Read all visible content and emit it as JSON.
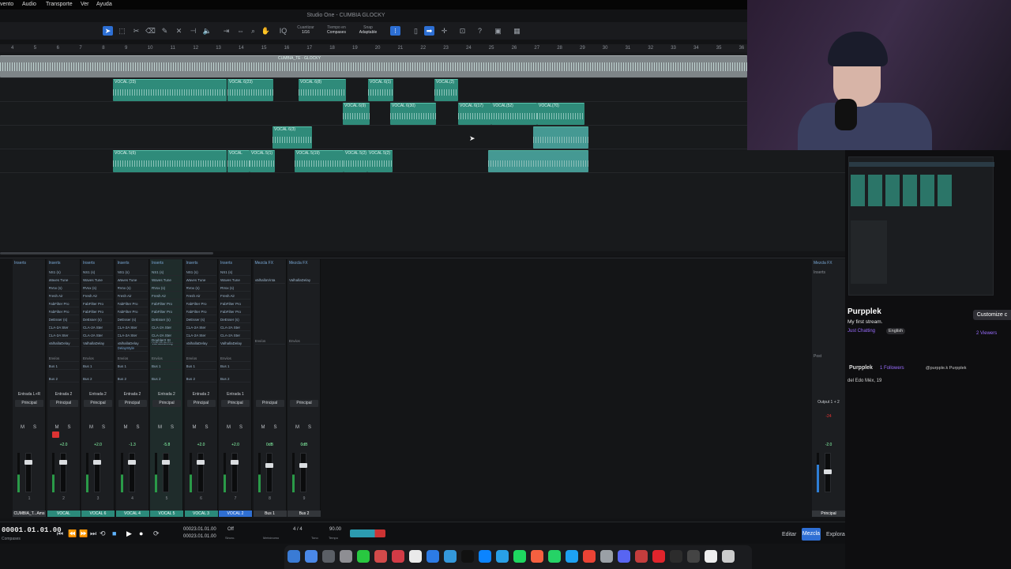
{
  "menubar": {
    "items": [
      "vento",
      "Audio",
      "Transporte",
      "Ver",
      "Ayuda"
    ]
  },
  "window": {
    "title": "Studio One - CUMBIA GLOCKY"
  },
  "toolbar": {
    "quantize_label": "Cuantizar",
    "quantize_value": "1/16",
    "timebase_label": "Tiempo en",
    "timebase_value": "Compases",
    "snap_label": "Snap",
    "snap_value": "Adaptable"
  },
  "ruler": {
    "marks": [
      "4",
      "5",
      "6",
      "7",
      "8",
      "9",
      "10",
      "11",
      "12",
      "13",
      "14",
      "15",
      "16",
      "17",
      "18",
      "19",
      "20",
      "21",
      "22",
      "23",
      "24",
      "25",
      "26",
      "27",
      "28",
      "29",
      "30",
      "31",
      "32",
      "33",
      "34",
      "35",
      "36"
    ]
  },
  "clips": {
    "master": "CUMBIA_TE - GLOCKY",
    "row1": [
      "VOCAL (23)",
      "VOCAL 6(23)",
      "VOCAL 6(8)",
      "VOCAL 6(1)",
      "VOCAL(2)"
    ],
    "row2": [
      "VOCAL 6(9)",
      "VOCAL 6(30)",
      "VOCAL 6(17)",
      "VOCAL(52)",
      "VOCAL(70)"
    ],
    "row3": [
      "VOCAL 6(3)"
    ],
    "row4": [
      "VOCAL 5(6)",
      "VOCAL",
      "VOCAL 5(1)",
      "VOCAL 5(19)",
      "VOCAL 5(2)",
      "VOCAL 5(2)"
    ]
  },
  "mixer": {
    "inserts_label": "Inserts",
    "sends_label": "Envíos",
    "mix_fx_label": "Mezcla FX",
    "post_label": "Post",
    "add_label": "+",
    "insert_plugins": [
      "NS1 (s)",
      "Waves Tune",
      "RVox (s)",
      "Fresh Air",
      "FabFilter Pro",
      "FabFilter Pro",
      "DeEsser (s)",
      "CLA-2A Ster",
      "CLA-2A Ster",
      "ValhallaDelay"
    ],
    "bus1_fx": "ValhallaVinta",
    "bus2_fx": "ValhallaDelay",
    "extra_plugins": {
      "ch4": "DelayStyle",
      "ch5": "Doubler2 St"
    },
    "sends": [
      "Bus 1",
      "Bus 2"
    ],
    "main_output": "Principal",
    "channels": [
      {
        "input": "Entrada L+R",
        "output": "Principal",
        "vol": "",
        "num": "1",
        "name": "CUMBIA_T...Ams",
        "style": "plain"
      },
      {
        "input": "Entrada 2",
        "output": "Principal",
        "vol": "+2.0",
        "num": "2",
        "name": "VOCAL",
        "style": "teal"
      },
      {
        "input": "Entrada 2",
        "output": "Principal",
        "vol": "+2.0",
        "num": "3",
        "name": "VOCAL 6",
        "style": "teal"
      },
      {
        "input": "Entrada 2",
        "output": "Principal",
        "vol": "-1.3",
        "num": "4",
        "name": "VOCAL 4",
        "style": "teal"
      },
      {
        "input": "Entrada 2",
        "output": "Principal",
        "vol": "-5.8",
        "num": "5",
        "name": "VOCAL 5",
        "style": "teal"
      },
      {
        "input": "Entrada 2",
        "output": "Principal",
        "vol": "+2.0",
        "num": "6",
        "name": "VOCAL 3",
        "style": "teal"
      },
      {
        "input": "Entrada 1",
        "output": "Principal",
        "vol": "+2.0",
        "num": "7",
        "name": "VOCAL 2",
        "style": "blue"
      },
      {
        "input": "",
        "output": "Principal",
        "vol": "0dB",
        "num": "8",
        "name": "Bus 1",
        "style": "plain"
      },
      {
        "input": "",
        "output": "Principal",
        "vol": "0dB",
        "num": "9",
        "name": "Bus 2",
        "style": "plain"
      }
    ],
    "main": {
      "output": "Output 1 + 2",
      "peak": "-24",
      "vol": "-2.0",
      "name": "Principal"
    }
  },
  "transport": {
    "timecode": "00001.01.01.00",
    "timecode_sub": "Compases",
    "position_a": "00023.01.01.00",
    "position_b": "00023.01.01.00",
    "click": "Off",
    "meter": "4 / 4",
    "tempo": "90.00",
    "metronome_label": "Metrónomo",
    "signature_label": "Tono",
    "tempo_label": "Tempo",
    "sync_label": "Sincro."
  },
  "nav": {
    "edit": "Editar",
    "mix": "Mezcla",
    "browse": "Explorar"
  },
  "dock": {
    "colors": [
      "#3a7bd5",
      "#4a88e8",
      "#5b5f66",
      "#8e8e93",
      "#28c840",
      "#d24a4a",
      "#d23b46",
      "#eaeaea",
      "#2c7be5",
      "#3498db",
      "#111111",
      "#0b84ff",
      "#29a0e6",
      "#1ed760",
      "#f56040",
      "#25d366",
      "#1da1f2",
      "#ea4335",
      "#9aa0a6",
      "#5865f2",
      "#c43d3d",
      "#e0242c",
      "#2c2c2c",
      "#444444",
      "#eeeeee",
      "#cccccc"
    ]
  },
  "twitch": {
    "streamer": "Purpplek",
    "title": "My first stream.",
    "category": "Just Chatting",
    "language": "English",
    "customize": "Customize c",
    "viewers": "2 Viewers",
    "about_name": "Purpplek",
    "followers": "1 Followers",
    "socials": "@purpple.k   Purpplek",
    "location": "del Edo Méx, 19"
  }
}
